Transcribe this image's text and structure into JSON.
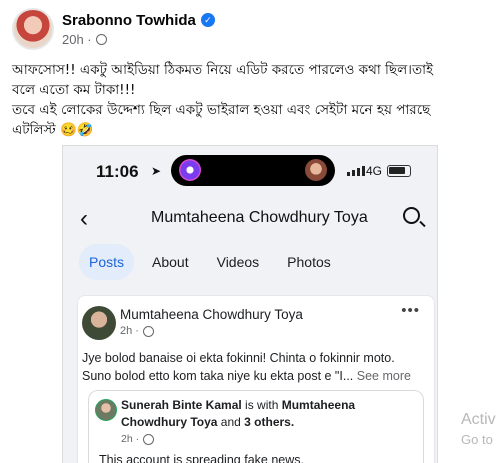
{
  "post": {
    "author": "Srabonno Towhida",
    "time": "20h ·",
    "text_line1": "আফসোস!! একটু আইডিয়া ঠিকমত নিয়ে এডিট করতে পারলেও কথা ছিল।তাই",
    "text_line2": "বলে এতো কম টাকা!!!",
    "text_line3": "তবে এই লোকের উদ্দেশ্য ছিল একটু ভাইরাল হওয়া এবং সেইটা মনে হয় পারছে",
    "text_line4": "এটলিস্ট 🥴🤣"
  },
  "screenshot": {
    "status": {
      "time": "11:06",
      "network": "4G"
    },
    "nav": {
      "title": "Mumtaheena Chowdhury Toya"
    },
    "tabs": [
      "Posts",
      "About",
      "Videos",
      "Photos"
    ],
    "card": {
      "author": "Mumtaheena Chowdhury Toya",
      "time": "2h ·",
      "body_line1": "Jye bolod banaise oi ekta fokinni! Chinta o fokinnir moto.",
      "body_line2": "Suno bolod etto kom taka niye ku ekta post e \"I...",
      "see_more": "See more",
      "share": {
        "name": "Sunerah Binte Kamal",
        "with_text": "is with",
        "tagged": "Mumtaheena Chowdhury Toya",
        "and_text": "and",
        "others": "3 others.",
        "time": "2h ·",
        "text": "This account is spreading fake news."
      }
    }
  },
  "watermark": {
    "line1": "Activ",
    "line2": "Go to"
  },
  "colors": {
    "accent": "#1877f2",
    "tab_active_bg": "#e3ecfa",
    "meta": "#65676b"
  }
}
